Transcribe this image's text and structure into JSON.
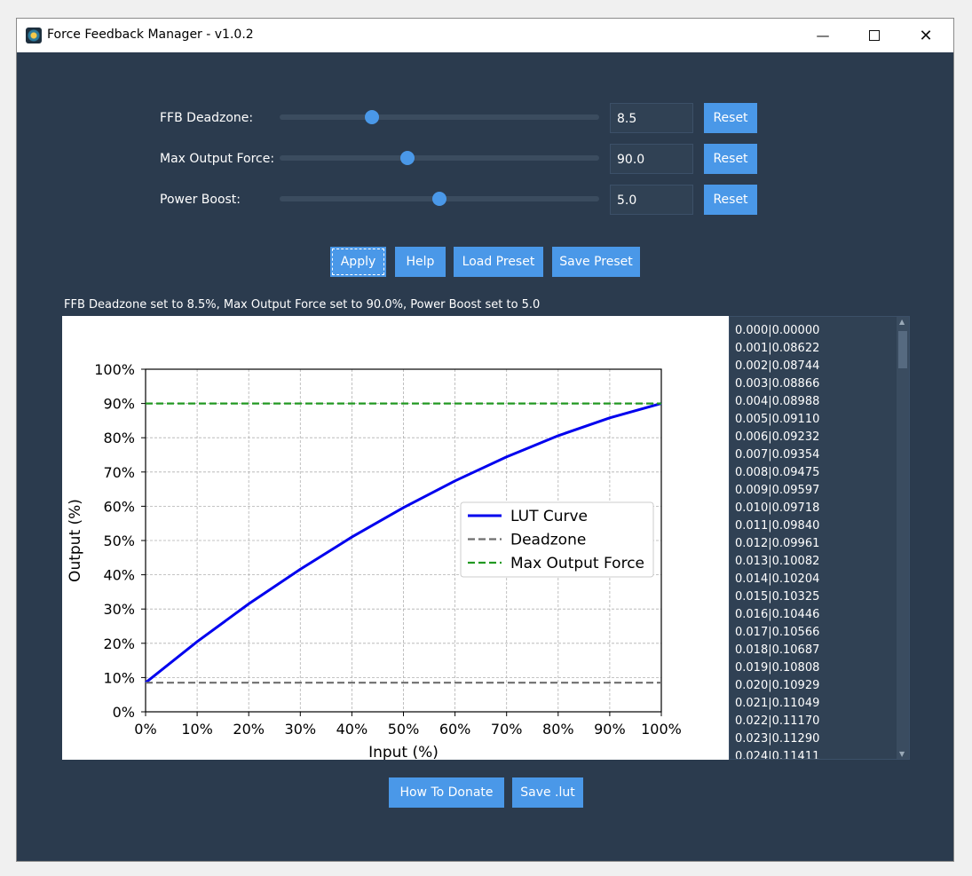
{
  "window": {
    "title": "Force Feedback Manager - v1.0.2",
    "minimize": "—",
    "close": "✕"
  },
  "sliders": [
    {
      "label": "FFB Deadzone:",
      "value": "8.5",
      "slider_fraction": 0.29,
      "reset_label": "Reset"
    },
    {
      "label": "Max Output Force:",
      "value": "90.0",
      "slider_fraction": 0.4,
      "reset_label": "Reset"
    },
    {
      "label": "Power Boost:",
      "value": "5.0",
      "slider_fraction": 0.5,
      "reset_label": "Reset"
    }
  ],
  "actions": {
    "apply": "Apply",
    "help": "Help",
    "load_preset": "Load Preset",
    "save_preset": "Save Preset"
  },
  "status": "FFB Deadzone set to 8.5%, Max Output Force set to 90.0%, Power Boost set to 5.0",
  "chart_data": {
    "type": "line",
    "xlabel": "Input (%)",
    "ylabel": "Output (%)",
    "xlim": [
      0,
      100
    ],
    "ylim": [
      0,
      100
    ],
    "x_ticks": [
      "0%",
      "10%",
      "20%",
      "30%",
      "40%",
      "50%",
      "60%",
      "70%",
      "80%",
      "90%",
      "100%"
    ],
    "y_ticks": [
      "0%",
      "10%",
      "20%",
      "30%",
      "40%",
      "50%",
      "60%",
      "70%",
      "80%",
      "90%",
      "100%"
    ],
    "grid": true,
    "legend_position": "center-right",
    "series": [
      {
        "name": "LUT Curve",
        "color": "#0000ee",
        "style": "solid",
        "x": [
          0,
          10,
          20,
          30,
          40,
          50,
          60,
          70,
          80,
          90,
          100
        ],
        "y": [
          8.5,
          20.5,
          31.5,
          41.6,
          51.0,
          59.6,
          67.4,
          74.4,
          80.6,
          85.8,
          90.0
        ]
      },
      {
        "name": "Deadzone",
        "color": "#6e6e6e",
        "style": "dashed",
        "x": [
          0,
          100
        ],
        "y": [
          8.5,
          8.5
        ]
      },
      {
        "name": "Max Output Force",
        "color": "#229922",
        "style": "dashed",
        "x": [
          0,
          100
        ],
        "y": [
          90.0,
          90.0
        ]
      }
    ]
  },
  "lut_entries": [
    "0.000|0.00000",
    "0.001|0.08622",
    "0.002|0.08744",
    "0.003|0.08866",
    "0.004|0.08988",
    "0.005|0.09110",
    "0.006|0.09232",
    "0.007|0.09354",
    "0.008|0.09475",
    "0.009|0.09597",
    "0.010|0.09718",
    "0.011|0.09840",
    "0.012|0.09961",
    "0.013|0.10082",
    "0.014|0.10204",
    "0.015|0.10325",
    "0.016|0.10446",
    "0.017|0.10566",
    "0.018|0.10687",
    "0.019|0.10808",
    "0.020|0.10929",
    "0.021|0.11049",
    "0.022|0.11170",
    "0.023|0.11290",
    "0.024|0.11411"
  ],
  "footer": {
    "donate": "How To Donate",
    "save_lut": "Save .lut"
  },
  "colors": {
    "background": "#2b3b4e",
    "button": "#4a98e8",
    "field": "#304154"
  }
}
